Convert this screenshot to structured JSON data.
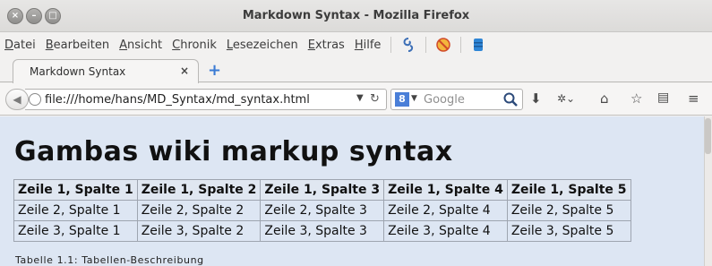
{
  "window": {
    "title": "Markdown Syntax - Mozilla Firefox",
    "buttons": [
      "×",
      "–",
      "□"
    ]
  },
  "menubar": {
    "items": [
      {
        "key": "D",
        "rest": "atei"
      },
      {
        "key": "B",
        "rest": "earbeiten"
      },
      {
        "key": "A",
        "rest": "nsicht"
      },
      {
        "key": "C",
        "rest": "hronik"
      },
      {
        "key": "L",
        "rest": "esezeichen"
      },
      {
        "key": "E",
        "rest": "xtras"
      },
      {
        "key": "H",
        "rest": "ilfe"
      }
    ]
  },
  "tab": {
    "label": "Markdown Syntax",
    "close": "×",
    "newtab": "+"
  },
  "navbar": {
    "url": "file:///home/hans/MD_Syntax/md_syntax.html",
    "search_placeholder": "Google",
    "search_engine_letter": "8"
  },
  "page": {
    "title": "Gambas wiki markup syntax",
    "table": {
      "header": [
        "Zeile 1, Spalte 1",
        "Zeile 1, Spalte 2",
        "Zeile 1, Spalte 3",
        "Zeile 1, Spalte 4",
        "Zeile 1, Spalte 5"
      ],
      "rows": [
        [
          "Zeile 2, Spalte 1",
          "Zeile 2, Spalte 2",
          "Zeile 2, Spalte 3",
          "Zeile 2, Spalte 4",
          "Zeile 2, Spalte 5"
        ],
        [
          "Zeile 3, Spalte 1",
          "Zeile 3, Spalte 2",
          "Zeile 3, Spalte 3",
          "Zeile 3, Spalte 4",
          "Zeile 3, Spalte 5"
        ]
      ]
    },
    "caption": "Tabelle 1.1: Tabellen-Beschreibung"
  },
  "colors": {
    "content_bg": "#dde6f3",
    "accent": "#3b7bd4"
  }
}
